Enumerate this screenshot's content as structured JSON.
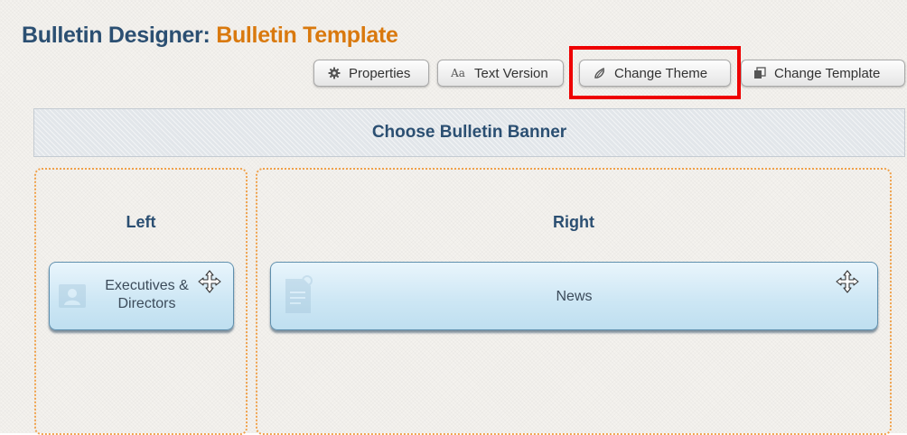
{
  "header": {
    "prefix": "Bulletin Designer:",
    "name": "Bulletin Template"
  },
  "toolbar": {
    "properties_label": "Properties",
    "properties_icon": "gear-icon",
    "text_version_label": "Text Version",
    "text_version_icon": "text-size-icon",
    "text_version_icon_text": "Aa",
    "change_theme_label": "Change Theme",
    "change_theme_icon": "theme-drop-icon",
    "change_template_label": "Change Template",
    "change_template_icon": "template-icon"
  },
  "banner": {
    "label": "Choose Bulletin Banner"
  },
  "zones": {
    "left": {
      "heading": "Left",
      "widget": {
        "line1": "Executives &",
        "line2": "Directors",
        "icon": "contact-card-icon"
      }
    },
    "right": {
      "heading": "Right",
      "widget": {
        "label": "News",
        "icon": "news-document-icon"
      }
    }
  },
  "colors": {
    "title_blue": "#2b4f72",
    "title_orange": "#d9790e",
    "highlight_red": "#ee0000",
    "zone_border_orange": "#f0a14a"
  }
}
